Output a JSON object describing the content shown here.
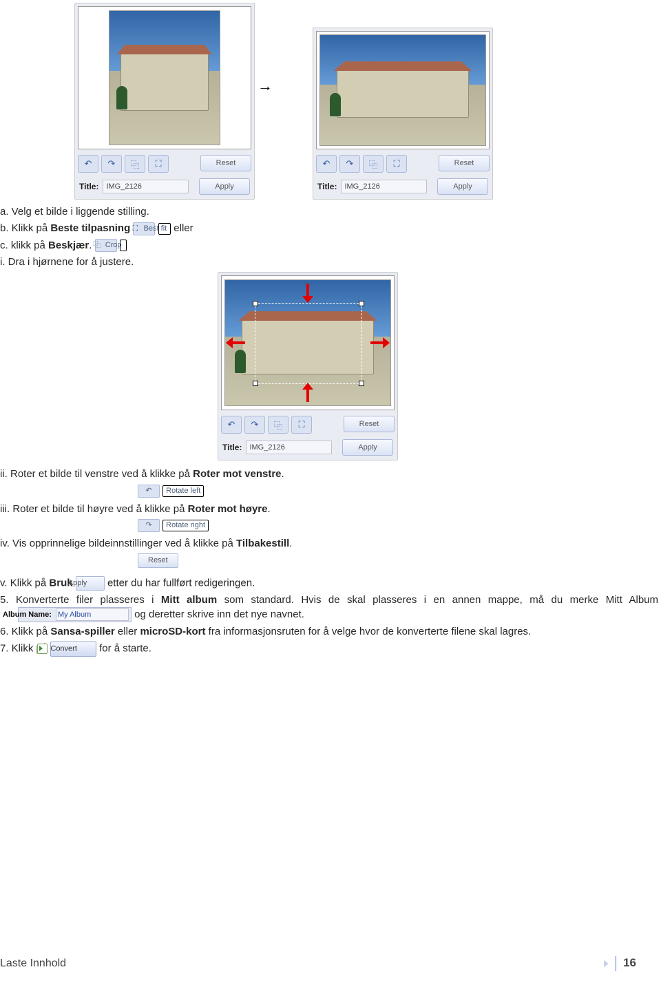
{
  "panel1": {
    "title_label": "Title:",
    "title_value": "IMG_2126",
    "reset": "Reset",
    "apply": "Apply"
  },
  "arrow": "→",
  "panel2": {
    "title_label": "Title:",
    "title_value": "IMG_2126",
    "reset": "Reset",
    "apply": "Apply"
  },
  "steps": {
    "a": "a.  Velg et bilde i liggende stilling.",
    "b_pre": "b.  Klikk på ",
    "b_bold": "Beste tilpasning",
    "bestfit_icon": "⛶",
    "bestfit_label": "Best fit",
    "b_post": " eller",
    "c_pre": "c.  klikk på ",
    "c_bold": "Beskjær",
    "c_suffix": ".",
    "crop_icon": "⿻",
    "crop_label": "Crop",
    "i": "i.  Dra i hjørnene for å justere."
  },
  "panel3": {
    "title_label": "Title:",
    "title_value": "IMG_2126",
    "reset": "Reset",
    "apply": "Apply"
  },
  "roman": {
    "ii_pre": "ii.  Roter et bilde til venstre ved å klikke på ",
    "ii_bold": "Roter mot venstre",
    "rot_left_icon": "↶",
    "rot_left_label": "Rotate left",
    "iii_pre": "iii.  Roter et bilde til høyre ved å klikke på ",
    "iii_bold": "Roter mot høyre",
    "rot_right_icon": "↷",
    "rot_right_label": "Rotate right",
    "iv_pre": "iv.  Vis opprinnelige bildeinnstillinger ved å klikke på ",
    "iv_bold": "Tilbakestill",
    "reset_btn": "Reset",
    "v_pre": "v.  Klikk på ",
    "v_bold": "Bruk",
    "apply_btn": "Apply",
    "v_post": " etter du har fullført redigeringen."
  },
  "n5": {
    "pre": "5.  Konverterte filer plasseres i ",
    "bold1": "Mitt album",
    "mid": " som standard. Hvis de skal plasseres i en annen mappe, må du merke Mitt Album ",
    "album_label": "Album Name:",
    "album_value": "My Album",
    "post": " og deretter skrive inn det nye navnet."
  },
  "n6": {
    "pre": "6.  Klikk på ",
    "b1": "Sansa-spiller",
    "mid1": " eller ",
    "b2": "microSD-kort",
    "post": " fra informasjonsruten for å velge hvor de konverterte filene skal lagres."
  },
  "n7": {
    "pre": "7.  Klikk på ",
    "convert_label": "Convert",
    "post": " for å starte."
  },
  "footer": {
    "text": "Laste Innhold",
    "page": "16"
  },
  "icons": {
    "rot_left": "↶",
    "rot_right": "↷",
    "crop": "⿻",
    "fit": "⛶"
  }
}
